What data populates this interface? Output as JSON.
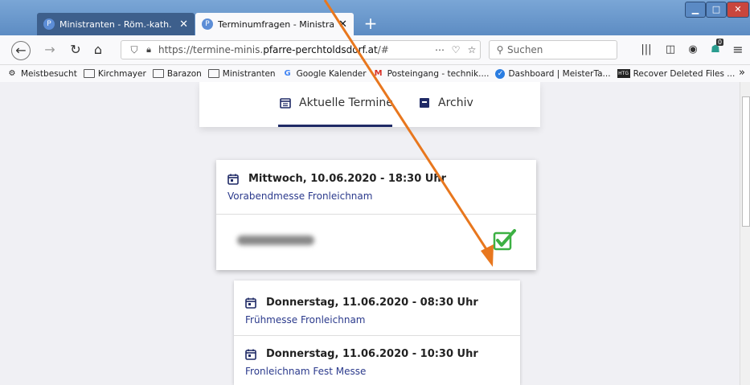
{
  "browser": {
    "tabs": [
      {
        "title": "Ministranten - Röm.-kath. Pfarr",
        "active": false
      },
      {
        "title": "Terminumfragen - Ministranten",
        "active": true
      }
    ],
    "new_tab_label": "+",
    "close_glyph": "✕",
    "url_host_prefix": "https://termine-minis.",
    "url_host_main": "pfarre-perchtoldsdorf.at",
    "url_path": "/#",
    "search_placeholder": "Suchen",
    "bookmarks": [
      {
        "label": "Meistbesucht",
        "icon": "gear-icon"
      },
      {
        "label": "Kirchmayer",
        "icon": "folder-icon"
      },
      {
        "label": "Barazon",
        "icon": "folder-icon"
      },
      {
        "label": "Ministranten",
        "icon": "folder-icon"
      },
      {
        "label": "Google Kalender",
        "icon": "google-icon"
      },
      {
        "label": "Posteingang - technik....",
        "icon": "gmail-icon"
      },
      {
        "label": "Dashboard | MeisterTa...",
        "icon": "check-circle-icon"
      },
      {
        "label": "Recover Deleted Files ...",
        "icon": "htg-icon"
      }
    ],
    "badge_count": "0"
  },
  "nav": {
    "current_label": "Aktuelle Termine",
    "archive_label": "Archiv"
  },
  "events": [
    {
      "date": "Mittwoch, 10.06.2020 - 18:30 Uhr",
      "name": "Vorabendmesse Fronleichnam",
      "confirmed": true
    },
    {
      "date": "Donnerstag, 11.06.2020 - 08:30 Uhr",
      "name": "Frühmesse Fronleichnam"
    },
    {
      "date": "Donnerstag, 11.06.2020 - 10:30 Uhr",
      "name": "Fronleichnam Fest Messe"
    }
  ],
  "colors": {
    "accent": "#1f2a66",
    "link": "#2b3a8c",
    "check": "#3cb043",
    "annotation_arrow": "#e8771e"
  }
}
